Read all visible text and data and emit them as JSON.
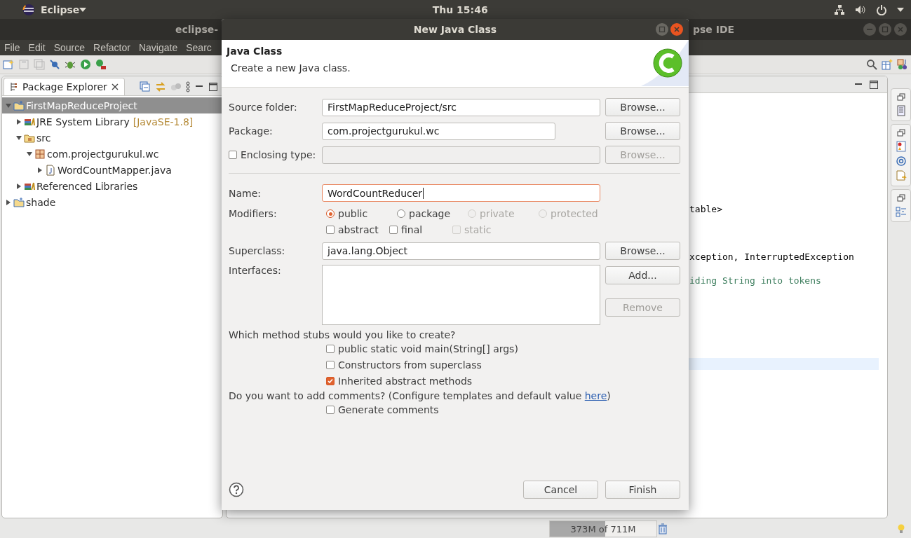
{
  "top_bar": {
    "app_menu": "Eclipse",
    "clock": "Thu 15:46"
  },
  "ide_window": {
    "title_left": "eclipse-",
    "title_right": "pse IDE"
  },
  "menu_bar": [
    "File",
    "Edit",
    "Source",
    "Refactor",
    "Navigate",
    "Searc"
  ],
  "package_explorer": {
    "title": "Package Explorer",
    "tree": [
      {
        "label": "FirstMapReduceProject",
        "kind": "project",
        "expanded": true,
        "selected": true,
        "children": [
          {
            "label": "JRE System Library",
            "decoration": "[JavaSE-1.8]",
            "kind": "library",
            "expanded": false,
            "selected": false
          },
          {
            "label": "src",
            "kind": "folder",
            "expanded": true,
            "selected": false,
            "children": [
              {
                "label": "com.projectgurukul.wc",
                "kind": "package",
                "expanded": true,
                "selected": false,
                "children": [
                  {
                    "label": "WordCountMapper.java",
                    "kind": "java",
                    "expanded": false,
                    "selected": false
                  }
                ]
              }
            ]
          },
          {
            "label": "Referenced Libraries",
            "kind": "library",
            "expanded": false,
            "selected": false
          }
        ]
      },
      {
        "label": "shade",
        "kind": "project",
        "expanded": false,
        "selected": false
      }
    ]
  },
  "editor": {
    "lines": [
      {
        "text": "table>",
        "kind": "code"
      },
      {
        "text": "xception, InterruptedException",
        "kind": "code"
      },
      {
        "text": "iding String into tokens",
        "kind": "comment"
      }
    ]
  },
  "status_bar": {
    "memory": {
      "reading": "373M of 711M",
      "level": 0.52
    }
  },
  "dialog": {
    "title": "New Java Class",
    "header": {
      "title": "Java Class",
      "description": "Create a new Java class."
    },
    "source_folder": {
      "label": "Source folder:",
      "value": "FirstMapReduceProject/src",
      "button": "Browse...",
      "disabled": false
    },
    "package": {
      "label": "Package:",
      "value": "com.projectgurukul.wc",
      "button": "Browse...",
      "disabled": false
    },
    "enclosing_type": {
      "label": "Enclosing type:",
      "checked": false,
      "button": "Browse...",
      "disabled": true
    },
    "name": {
      "label": "Name:",
      "value": "WordCountReducer",
      "focused": true
    },
    "modifiers": {
      "label": "Modifiers:",
      "access": [
        {
          "label": "public",
          "selected": true,
          "disabled": false
        },
        {
          "label": "package",
          "selected": false,
          "disabled": false
        },
        {
          "label": "private",
          "selected": false,
          "disabled": true
        },
        {
          "label": "protected",
          "selected": false,
          "disabled": true
        }
      ],
      "flags": [
        {
          "label": "abstract",
          "checked": false,
          "disabled": false
        },
        {
          "label": "final",
          "checked": false,
          "disabled": false
        },
        {
          "label": "static",
          "checked": false,
          "disabled": true
        }
      ]
    },
    "superclass": {
      "label": "Superclass:",
      "value": "java.lang.Object",
      "button": "Browse...",
      "disabled": false
    },
    "interfaces": {
      "label": "Interfaces:",
      "buttons": [
        {
          "label": "Add...",
          "disabled": false
        },
        {
          "label": "Remove",
          "disabled": true
        }
      ]
    },
    "stubs": {
      "question": "Which method stubs would you like to create?",
      "options": [
        {
          "label": "public static void main(String[] args)",
          "checked": false
        },
        {
          "label": "Constructors from superclass",
          "checked": false
        },
        {
          "label": "Inherited abstract methods",
          "checked": true
        }
      ]
    },
    "comments": {
      "question": "Do you want to add comments? (Configure templates and default value ",
      "link": "here",
      "suffix": ")",
      "option": {
        "label": "Generate comments",
        "checked": false
      }
    },
    "footer_buttons": [
      {
        "label": "Cancel"
      },
      {
        "label": "Finish"
      }
    ]
  }
}
